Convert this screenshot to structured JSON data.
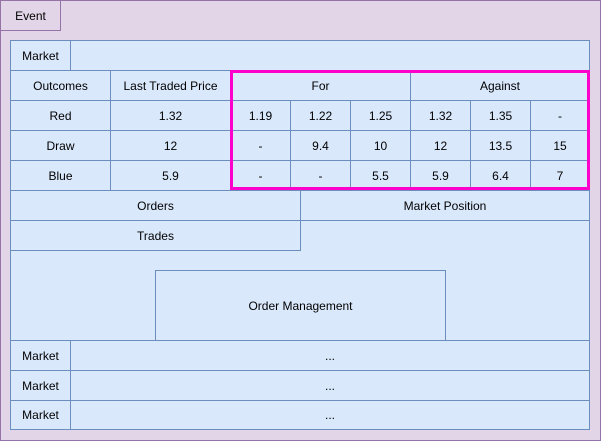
{
  "event": {
    "label": "Event"
  },
  "market": {
    "label": "Market"
  },
  "table": {
    "headers": {
      "outcomes": "Outcomes",
      "last_traded_price": "Last Traded Price",
      "for": "For",
      "against": "Against"
    },
    "rows": [
      {
        "outcome": "Red",
        "ltp": "1.32",
        "for": [
          "1.19",
          "1.22",
          "1.25"
        ],
        "against": [
          "1.32",
          "1.35",
          "-"
        ]
      },
      {
        "outcome": "Draw",
        "ltp": "12",
        "for": [
          "-",
          "9.4",
          "10"
        ],
        "against": [
          "12",
          "13.5",
          "15"
        ]
      },
      {
        "outcome": "Blue",
        "ltp": "5.9",
        "for": [
          "-",
          "-",
          "5.5"
        ],
        "against": [
          "5.9",
          "6.4",
          "7"
        ]
      }
    ]
  },
  "sections": {
    "orders": "Orders",
    "market_position": "Market Position",
    "trades": "Trades",
    "order_management": "Order Management"
  },
  "other_markets": [
    {
      "label": "Market",
      "value": "..."
    },
    {
      "label": "Market",
      "value": "..."
    },
    {
      "label": "Market",
      "value": "..."
    }
  ],
  "colors": {
    "event_fill": "#e1d5e7",
    "event_stroke": "#9673a6",
    "cell_fill": "#dae8fc",
    "cell_stroke": "#6c8ebf",
    "highlight": "#ff00cc"
  }
}
